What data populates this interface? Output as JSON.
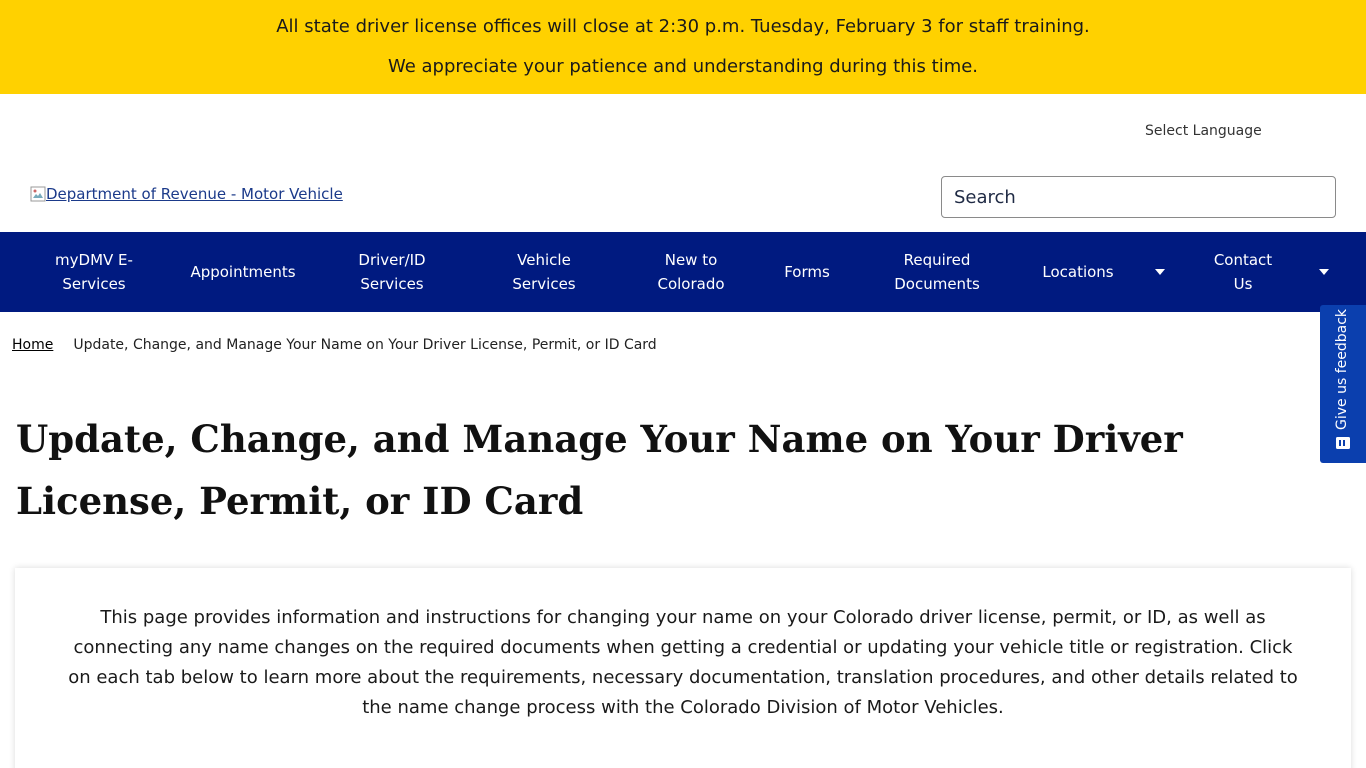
{
  "alert": {
    "line1": "All state driver license offices will close at 2:30 p.m. Tuesday, February 3 for staff training.",
    "line2": "We appreciate your patience and understanding during this time."
  },
  "header": {
    "language_label": "Select Language",
    "logo_alt": "Department of Revenue - Motor Vehicle",
    "search_placeholder": "Search"
  },
  "nav": {
    "items": [
      {
        "label": "myDMV E-Services"
      },
      {
        "label": "Appointments"
      },
      {
        "label": "Driver/ID Services"
      },
      {
        "label": "Vehicle Services"
      },
      {
        "label": "New to Colorado"
      },
      {
        "label": "Forms"
      },
      {
        "label": "Required Documents"
      },
      {
        "label": "Locations"
      },
      {
        "label": "Contact Us"
      }
    ]
  },
  "feedback": {
    "label": "Give us feedback"
  },
  "breadcrumb": {
    "home": "Home",
    "current": "Update, Change, and Manage Your Name on Your Driver License, Permit, or ID Card"
  },
  "page": {
    "title": "Update, Change, and Manage Your Name on Your Driver License, Permit, or ID Card",
    "intro": "This page provides information and instructions for changing your name on your Colorado driver license, permit, or ID, as well as connecting any name changes on the required documents when getting a credential or updating your vehicle title or registration. Click on each tab below to learn more about the requirements, necessary documentation, translation procedures, and other details related to the name change process with the Colorado Division of Motor Vehicles."
  },
  "colors": {
    "alert_bg": "#ffd100",
    "nav_bg": "#001a80",
    "feedback_bg": "#0b3fae"
  }
}
